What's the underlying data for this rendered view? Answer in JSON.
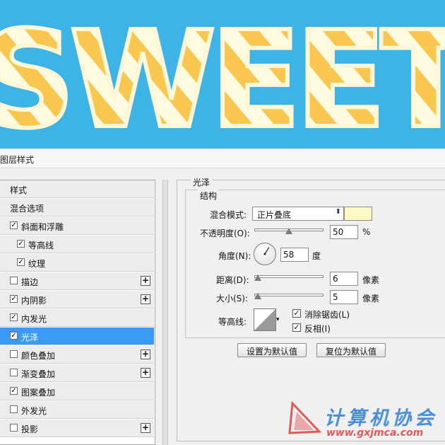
{
  "canvas": {
    "text": "SWEET",
    "background": "#3db3e6"
  },
  "dialog": {
    "title": "图层样式"
  },
  "styles": [
    {
      "label": "样式",
      "checkbox": false,
      "checked": false,
      "plus": false,
      "selected": false
    },
    {
      "label": "混合选项",
      "checkbox": false,
      "checked": false,
      "plus": false,
      "selected": false
    },
    {
      "label": "斜面和浮雕",
      "checkbox": true,
      "checked": true,
      "plus": false,
      "selected": false
    },
    {
      "label": "等高线",
      "checkbox": true,
      "checked": true,
      "plus": false,
      "selected": false,
      "indent": true
    },
    {
      "label": "纹理",
      "checkbox": true,
      "checked": true,
      "plus": false,
      "selected": false,
      "indent": true
    },
    {
      "label": "描边",
      "checkbox": true,
      "checked": false,
      "plus": true,
      "selected": false
    },
    {
      "label": "内阴影",
      "checkbox": true,
      "checked": true,
      "plus": true,
      "selected": false
    },
    {
      "label": "内发光",
      "checkbox": true,
      "checked": true,
      "plus": false,
      "selected": false
    },
    {
      "label": "光泽",
      "checkbox": true,
      "checked": true,
      "plus": false,
      "selected": true
    },
    {
      "label": "颜色叠加",
      "checkbox": true,
      "checked": false,
      "plus": true,
      "selected": false
    },
    {
      "label": "渐变叠加",
      "checkbox": true,
      "checked": false,
      "plus": true,
      "selected": false
    },
    {
      "label": "图案叠加",
      "checkbox": true,
      "checked": true,
      "plus": false,
      "selected": false
    },
    {
      "label": "外发光",
      "checkbox": true,
      "checked": false,
      "plus": false,
      "selected": false
    },
    {
      "label": "投影",
      "checkbox": true,
      "checked": false,
      "plus": true,
      "selected": false
    }
  ],
  "panel": {
    "section_title": "光泽",
    "group_title": "结构",
    "blend_mode_label": "混合模式:",
    "blend_mode_value": "正片叠底",
    "swatch_color": "#fff9c4",
    "opacity_label": "不透明度(O):",
    "opacity_value": "50",
    "opacity_unit": "%",
    "opacity_level": 0.5,
    "angle_label": "角度(N):",
    "angle_value": "58",
    "angle_unit": "度",
    "distance_label": "距离(D):",
    "distance_value": "6",
    "distance_unit": "像素",
    "size_label": "大小(S):",
    "size_value": "5",
    "size_unit": "像素",
    "contour_label": "等高线:",
    "antialias_label": "消除锯齿(L)",
    "antialias_checked": true,
    "invert_label": "反相(I)",
    "invert_checked": true,
    "set_default_label": "设置为默认值",
    "reset_default_label": "复位为默认值"
  },
  "watermark": {
    "text": "计算机协会",
    "url": "www.gxjmca.com"
  }
}
